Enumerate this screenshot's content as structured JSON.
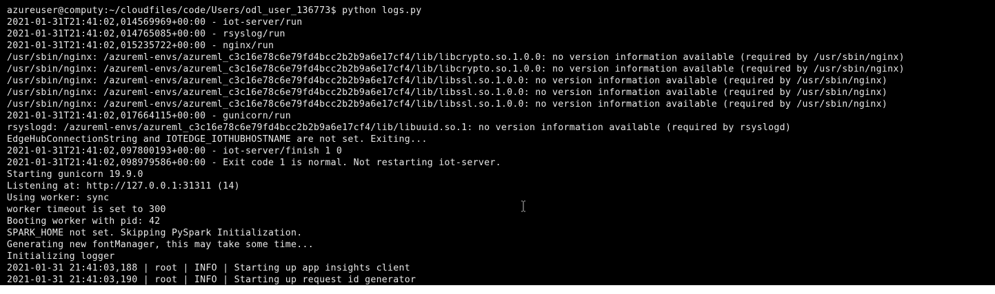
{
  "colors": {
    "background": "#000000",
    "foreground": "#e8e8e8",
    "cursor": "#c0c0c0"
  },
  "terminal": {
    "lines": [
      "azureuser@computy:~/cloudfiles/code/Users/odl_user_136773$ python logs.py",
      "2021-01-31T21:41:02,014569969+00:00 - iot-server/run",
      "2021-01-31T21:41:02,014765085+00:00 - rsyslog/run",
      "2021-01-31T21:41:02,015235722+00:00 - nginx/run",
      "/usr/sbin/nginx: /azureml-envs/azureml_c3c16e78c6e79fd4bcc2b2b9a6e17cf4/lib/libcrypto.so.1.0.0: no version information available (required by /usr/sbin/nginx)",
      "/usr/sbin/nginx: /azureml-envs/azureml_c3c16e78c6e79fd4bcc2b2b9a6e17cf4/lib/libcrypto.so.1.0.0: no version information available (required by /usr/sbin/nginx)",
      "/usr/sbin/nginx: /azureml-envs/azureml_c3c16e78c6e79fd4bcc2b2b9a6e17cf4/lib/libssl.so.1.0.0: no version information available (required by /usr/sbin/nginx)",
      "/usr/sbin/nginx: /azureml-envs/azureml_c3c16e78c6e79fd4bcc2b2b9a6e17cf4/lib/libssl.so.1.0.0: no version information available (required by /usr/sbin/nginx)",
      "/usr/sbin/nginx: /azureml-envs/azureml_c3c16e78c6e79fd4bcc2b2b9a6e17cf4/lib/libssl.so.1.0.0: no version information available (required by /usr/sbin/nginx)",
      "2021-01-31T21:41:02,017664115+00:00 - gunicorn/run",
      "rsyslogd: /azureml-envs/azureml_c3c16e78c6e79fd4bcc2b2b9a6e17cf4/lib/libuuid.so.1: no version information available (required by rsyslogd)",
      "EdgeHubConnectionString and IOTEDGE_IOTHUBHOSTNAME are not set. Exiting...",
      "2021-01-31T21:41:02,097800193+00:00 - iot-server/finish 1 0",
      "2021-01-31T21:41:02,098979586+00:00 - Exit code 1 is normal. Not restarting iot-server.",
      "Starting gunicorn 19.9.0",
      "Listening at: http://127.0.0.1:31311 (14)",
      "Using worker: sync",
      "worker timeout is set to 300",
      "Booting worker with pid: 42",
      "SPARK_HOME not set. Skipping PySpark Initialization.",
      "Generating new fontManager, this may take some time...",
      "Initializing logger",
      "2021-01-31 21:41:03,188 | root | INFO | Starting up app insights client",
      "2021-01-31 21:41:03,190 | root | INFO | Starting up request id generator"
    ]
  },
  "cursor": {
    "icon": "text-ibeam-cursor-icon"
  }
}
